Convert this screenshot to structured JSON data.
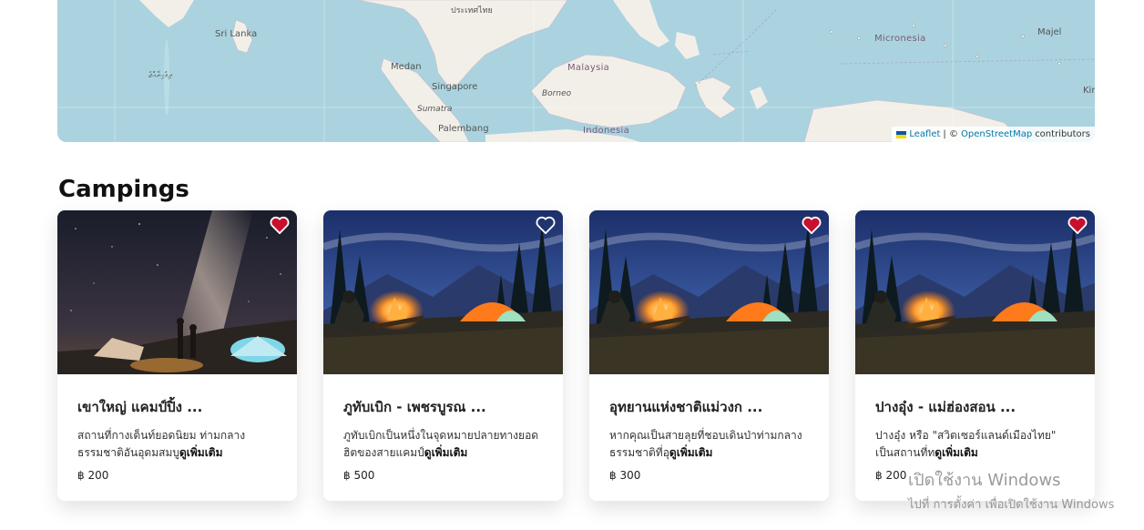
{
  "map": {
    "labels": {
      "sri_lanka": "Sri Lanka",
      "maldives": "ދިވެހިރާއްޖެ",
      "medan": "Medan",
      "singapore": "Singapore",
      "sumatra": "Sumatra",
      "palembang": "Palembang",
      "malaysia": "Malaysia",
      "borneo": "Borneo",
      "indonesia": "Indonesia",
      "micronesia": "Micronesia",
      "majel": "Majel",
      "kir": "Kir",
      "thailand_top": "ประเทศไทย"
    },
    "attribution": {
      "leaflet": "Leaflet",
      "separator": "| ©",
      "osm": "OpenStreetMap",
      "suffix": "contributors"
    }
  },
  "section": {
    "title": "Campings"
  },
  "cards": [
    {
      "title": "เขาใหญ่ แคมป์ปิ้ง  ...",
      "desc": "สถานที่กางเต็นท์ยอดนิยม ท่ามกลางธรรมชาติอันอุดมสมบู",
      "more": "ดูเพิ่มเติม",
      "price": "฿ 200",
      "favorite": true,
      "image": "milky-way-camp"
    },
    {
      "title": "ภูทับเบิก - เพชรบูรณ  ...",
      "desc": "ภูทับเบิกเป็นหนึ่งในจุดหมายปลายทางยอดฮิตของสายแคมป์",
      "more": "ดูเพิ่มเติม",
      "price": "฿ 500",
      "favorite": false,
      "image": "campfire-tent"
    },
    {
      "title": "อุทยานแห่งชาติแม่วงก  ...",
      "desc": "หากคุณเป็นสายลุยที่ชอบเดินป่าท่ามกลางธรรมชาติที่อุ",
      "more": "ดูเพิ่มเติม",
      "price": "฿ 300",
      "favorite": true,
      "image": "campfire-tent"
    },
    {
      "title": "ปางอุ๋ง - แม่ฮ่องสอน  ...",
      "desc": "ปางอุ๋ง หรือ \"สวิตเซอร์แลนด์เมืองไทย\" เป็นสถานที่ท",
      "more": "ดูเพิ่มเติม",
      "price": "฿ 200",
      "favorite": true,
      "image": "campfire-tent"
    }
  ],
  "watermark": {
    "line1": "เปิดใช้งาน Windows",
    "line2": "ไปที่ การตั้งค่า เพื่อเปิดใช้งาน Windows"
  },
  "colors": {
    "water": "#aad3df",
    "land": "#f2efe9",
    "heart_filled": "#c8102e",
    "link": "#0078a8"
  }
}
